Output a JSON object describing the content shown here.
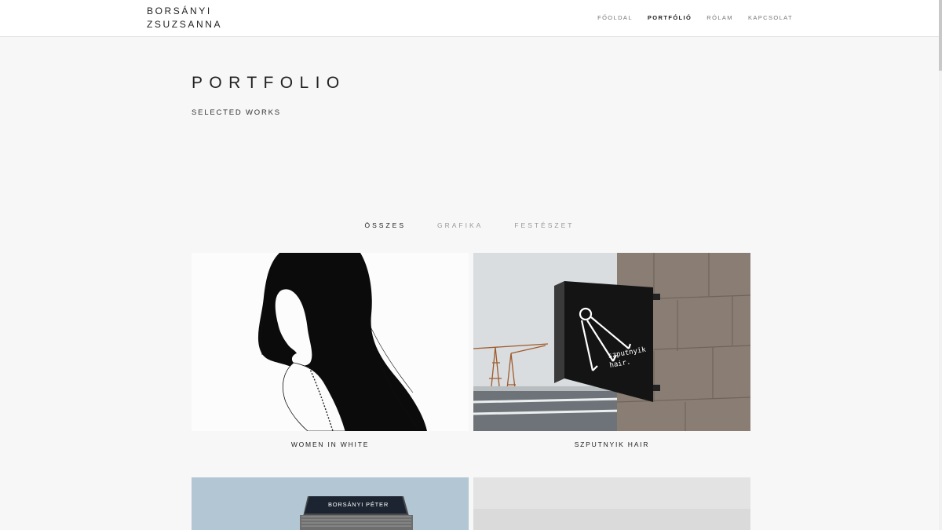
{
  "header": {
    "logo_line1": "BORSÁNYI",
    "logo_line2": "ZSUZSANNA",
    "nav": [
      {
        "label": "FŐOLDAL",
        "active": false
      },
      {
        "label": "PORTFÓLIÓ",
        "active": true
      },
      {
        "label": "RÓLAM",
        "active": false
      },
      {
        "label": "KAPCSOLAT",
        "active": false
      }
    ]
  },
  "hero": {
    "title": "PORTFOLIO",
    "subtitle": "SELECTED WORKS"
  },
  "filters": [
    {
      "label": "ÖSSZES",
      "active": true
    },
    {
      "label": "GRAFIKA",
      "active": false
    },
    {
      "label": "FESTÉSZET",
      "active": false
    }
  ],
  "works": [
    {
      "title": "WOMEN IN WHITE"
    },
    {
      "title": "SZPUTNYIK HAIR",
      "sign_text_1": "szputnyik",
      "sign_text_2": "hair."
    },
    {
      "card_text": "BORSÁNYI PÉTER"
    }
  ],
  "colors": {
    "page_bg": "#f7f7f7",
    "header_bg": "#ffffff",
    "text": "#222222",
    "muted": "#999999",
    "card_accent": "#e0892a"
  }
}
